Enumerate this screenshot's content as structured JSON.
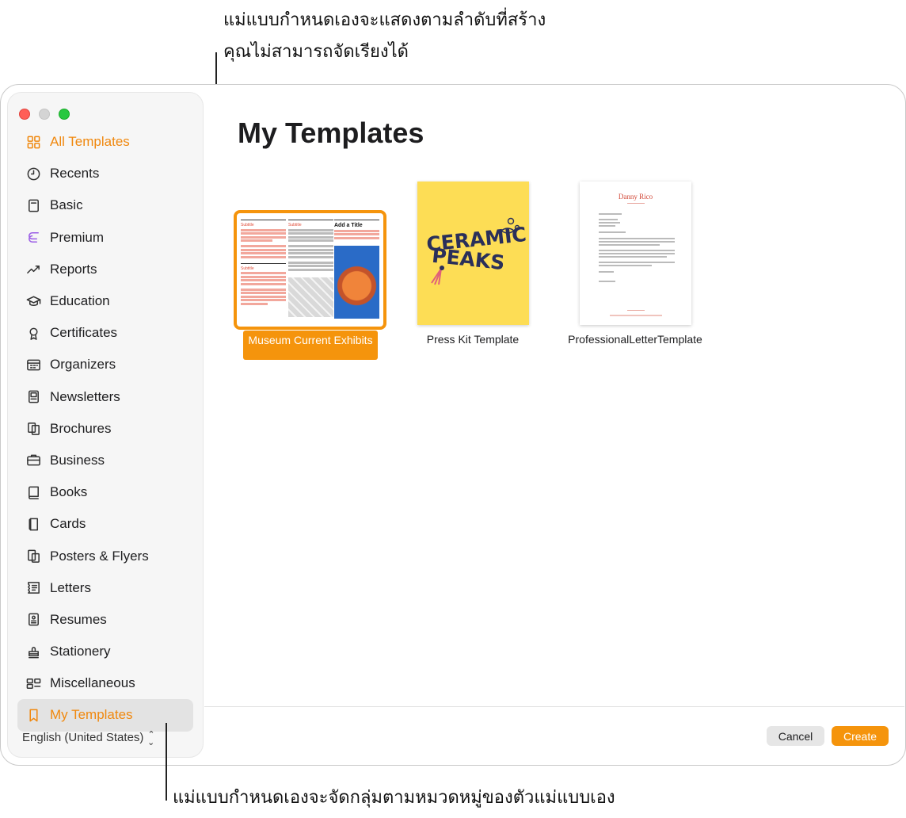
{
  "callouts": {
    "top_line1": "แม่แบบกำหนดเองจะแสดงตามลำดับที่สร้าง",
    "top_line2": "คุณไม่สามารถจัดเรียงได้",
    "bottom": "แม่แบบกำหนดเองจะจัดกลุ่มตามหมวดหมู่ของตัวแม่แบบเอง"
  },
  "sidebar": {
    "items": [
      {
        "label": "All Templates",
        "icon": "grid-icon"
      },
      {
        "label": "Recents",
        "icon": "clock-icon"
      },
      {
        "label": "Basic",
        "icon": "document-icon"
      },
      {
        "label": "Premium",
        "icon": "premium-icon"
      },
      {
        "label": "Reports",
        "icon": "chart-icon"
      },
      {
        "label": "Education",
        "icon": "graduation-cap-icon"
      },
      {
        "label": "Certificates",
        "icon": "ribbon-icon"
      },
      {
        "label": "Organizers",
        "icon": "calendar-icon"
      },
      {
        "label": "Newsletters",
        "icon": "newspaper-icon"
      },
      {
        "label": "Brochures",
        "icon": "brochure-icon"
      },
      {
        "label": "Business",
        "icon": "briefcase-icon"
      },
      {
        "label": "Books",
        "icon": "book-icon"
      },
      {
        "label": "Cards",
        "icon": "card-icon"
      },
      {
        "label": "Posters & Flyers",
        "icon": "poster-icon"
      },
      {
        "label": "Letters",
        "icon": "letter-icon"
      },
      {
        "label": "Resumes",
        "icon": "resume-icon"
      },
      {
        "label": "Stationery",
        "icon": "stamp-icon"
      },
      {
        "label": "Miscellaneous",
        "icon": "misc-icon"
      },
      {
        "label": "My Templates",
        "icon": "bookmark-icon"
      }
    ],
    "language": "English (United States)"
  },
  "main": {
    "title": "My Templates",
    "templates": [
      {
        "name": "Museum Current Exhibits",
        "selected": true
      },
      {
        "name": "Press Kit Template"
      },
      {
        "name": "ProfessionalLetterTemplate"
      }
    ],
    "thumb_text": {
      "subtitle": "Subtitle",
      "add_title": "Add a Title",
      "ceramic": "CERAMIC",
      "peaks": "PEAKS",
      "letter_name": "Danny Rico"
    }
  },
  "footer": {
    "cancel": "Cancel",
    "create": "Create"
  },
  "colors": {
    "accent": "#f5940c",
    "sidebar_accent_text": "#f0880e",
    "premium_icon": "#9b5de5"
  }
}
